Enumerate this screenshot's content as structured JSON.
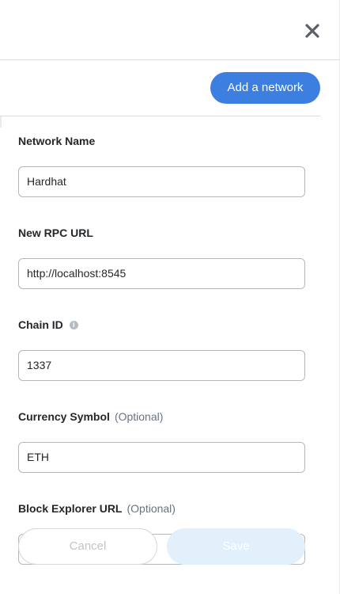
{
  "header": {
    "close_icon": "close-icon"
  },
  "toolbar": {
    "add_network_label": "Add a network"
  },
  "form": {
    "fields": [
      {
        "label": "Network Name",
        "optional": "",
        "value": "Hardhat",
        "info_icon": false
      },
      {
        "label": "New RPC URL",
        "optional": "",
        "value": "http://localhost:8545",
        "info_icon": false
      },
      {
        "label": "Chain ID",
        "optional": "",
        "value": "1337",
        "info_icon": true
      },
      {
        "label": "Currency Symbol",
        "optional": "(Optional)",
        "value": "ETH",
        "info_icon": false
      },
      {
        "label": "Block Explorer URL",
        "optional": "(Optional)",
        "value": "",
        "info_icon": false
      }
    ]
  },
  "footer": {
    "cancel_label": "Cancel",
    "save_label": "Save"
  },
  "colors": {
    "primary": "#3c7fe0",
    "save_disabled": "#e1f0fb",
    "cancel_text_disabled": "#bfc4c9"
  }
}
